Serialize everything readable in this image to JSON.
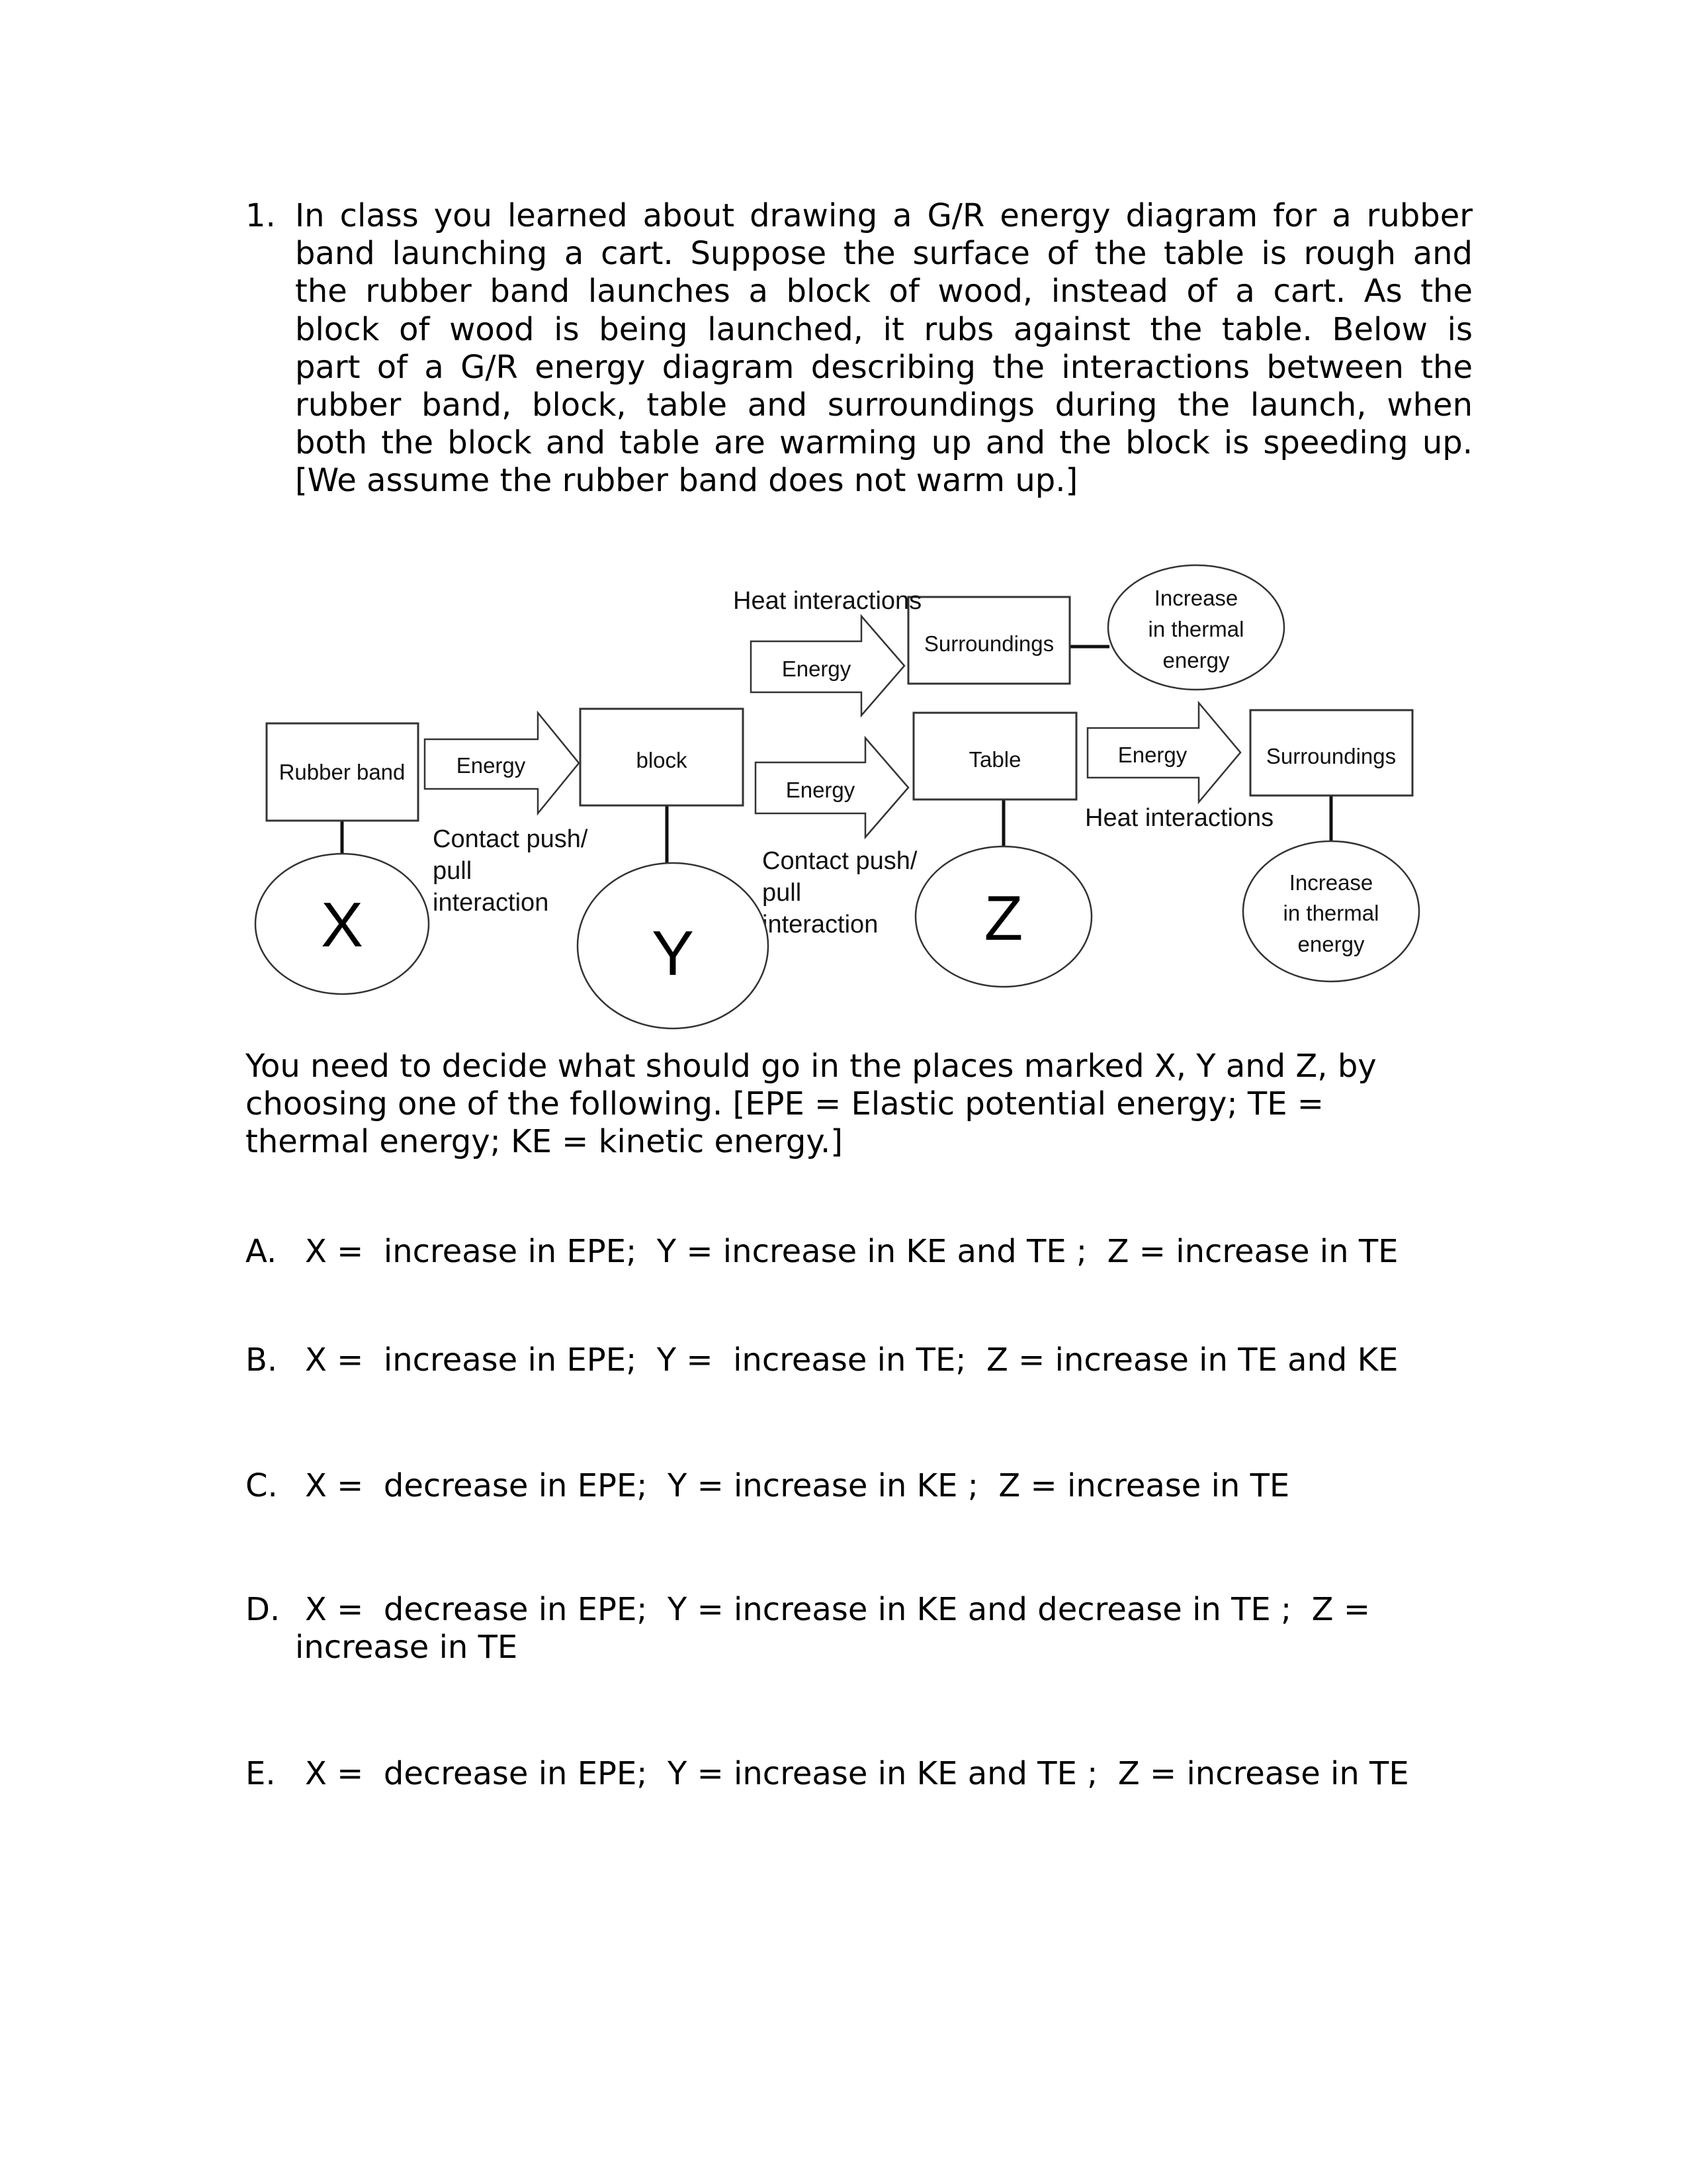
{
  "question": {
    "number": "1.",
    "lines": [
      "In class you learned about drawing a G/R energy diagram for a rubber",
      "band launching a cart.   Suppose the surface of the table is rough and",
      "the rubber band launches a block of wood, instead of a cart.  As the",
      "block of wood is being launched, it rubs against the table.  Below is",
      "part of a G/R energy diagram describing the interactions between the",
      "rubber band, block, table and surroundings during the launch, when",
      "both the block and table are warming up and the block is speeding up.",
      "[We assume the rubber band does not warm up.]"
    ]
  },
  "diagram": {
    "boxes": {
      "rubber_band": "Rubber band",
      "block": "block",
      "surroundings_top": "Surroundings",
      "table": "Table",
      "surroundings_right": "Surroundings"
    },
    "arrows": {
      "rubber_to_block": "Energy",
      "block_to_surroundings": "Energy",
      "block_to_table": "Energy",
      "table_to_surroundings": "Energy"
    },
    "annotations": {
      "heat_top": "Heat interactions",
      "contact_1": [
        "Contact push/",
        "pull",
        "interaction"
      ],
      "contact_2": [
        "Contact push/",
        "pull",
        "interaction"
      ],
      "heat_bottom": "Heat interactions"
    },
    "ellipses": {
      "x": "X",
      "y": "Y",
      "z": "Z",
      "thermal_top": [
        "Increase",
        "in thermal",
        "energy"
      ],
      "thermal_right": [
        "Increase",
        "in thermal",
        "energy"
      ]
    }
  },
  "instructions": [
    "You need to decide what should go in the places marked X, Y and Z, by",
    "choosing one of the following.  [EPE = Elastic potential energy; TE =",
    "thermal energy; KE = kinetic energy.]"
  ],
  "options": [
    {
      "letter": "A.",
      "text": "X =  increase in EPE;  Y = increase in KE and TE ;  Z = increase in TE"
    },
    {
      "letter": "B.",
      "text": "X =  increase in EPE;  Y =  increase in TE;  Z = increase in TE and KE"
    },
    {
      "letter": "C.",
      "text": "X =  decrease in EPE;  Y = increase in KE ;  Z = increase in TE"
    },
    {
      "letter": "D.",
      "text": "X =  decrease in EPE;  Y = increase in KE and decrease in TE ;  Z =",
      "text2": "increase in TE"
    },
    {
      "letter": "E.",
      "text": "X =  decrease in EPE;  Y = increase in KE and TE ;  Z = increase in TE"
    }
  ]
}
